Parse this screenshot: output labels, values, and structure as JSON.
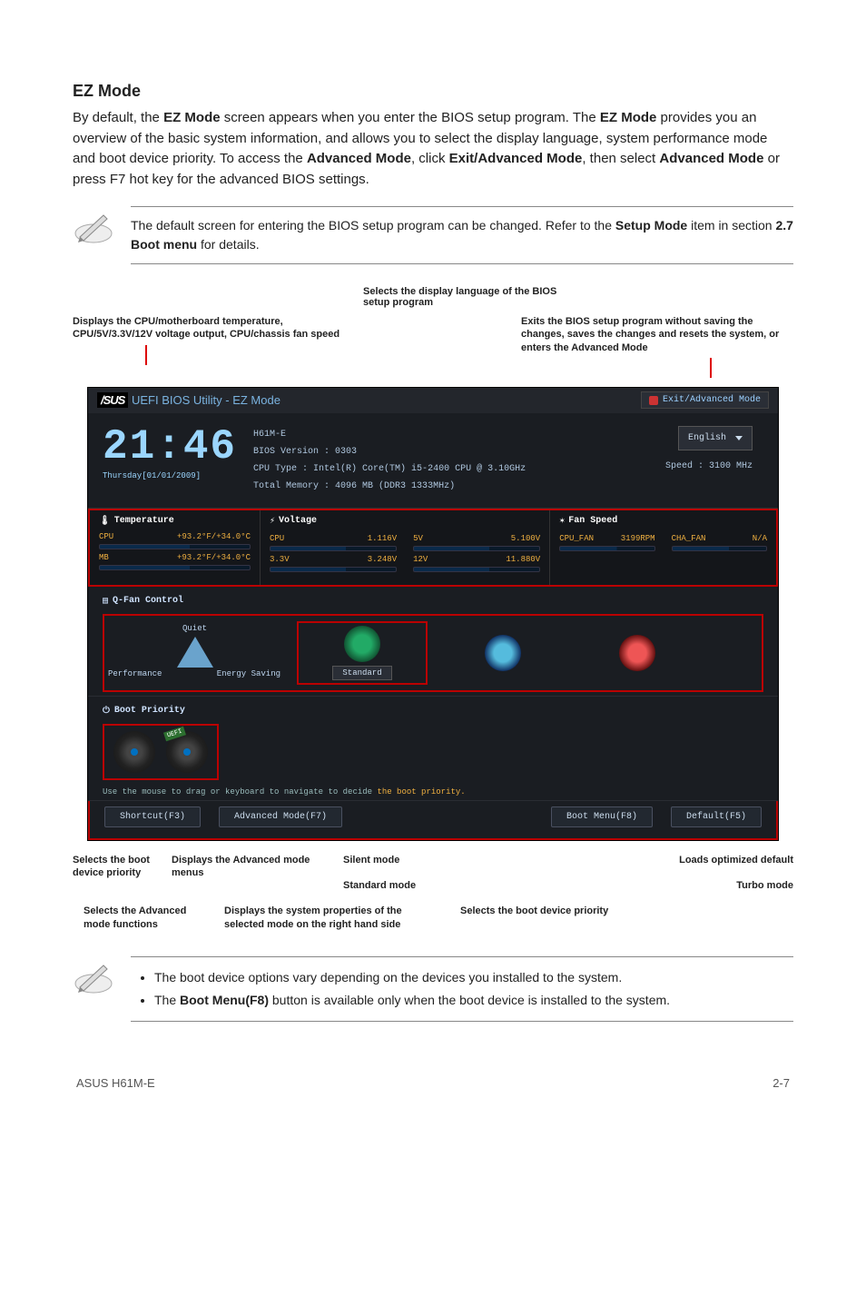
{
  "section_title": "EZ Mode",
  "body_paragraph_parts": [
    "By default, the ",
    "EZ Mode",
    " screen appears when you enter the BIOS setup program. The ",
    "EZ Mode",
    " provides you an overview of the basic system information, and allows you to select the display language, system performance mode and boot device priority. To access the ",
    "Advanced Mode",
    ", click ",
    "Exit/Advanced Mode",
    ", then select ",
    "Advanced Mode",
    " or press F7 hot key for the advanced BIOS settings."
  ],
  "note1_parts": [
    "The default screen for entering the BIOS setup program can be changed. Refer to the ",
    "Setup Mode",
    " item in section ",
    "2.7 Boot menu",
    " for details."
  ],
  "callouts": {
    "top_center": "Selects the display language of the BIOS setup program",
    "top_left": "Displays the CPU/motherboard temperature, CPU/5V/3.3V/12V voltage output, CPU/chassis fan speed",
    "top_right": "Exits the BIOS setup program without saving the changes, saves the changes and resets the system, or enters the Advanced Mode",
    "bottom_row1": {
      "boot_device": "Selects the boot device priority",
      "adv_menus": "Displays the Advanced mode menus",
      "silent": "Silent mode",
      "standard": "Standard mode",
      "loads_default": "Loads optimized default",
      "turbo": "Turbo mode"
    },
    "bottom_row2": {
      "adv_funcs": "Selects the Advanced mode functions",
      "sys_props": "Displays the system properties of the selected mode on the right hand side",
      "boot_prio": "Selects the boot device priority"
    }
  },
  "bios": {
    "brand": "/SUS",
    "header": "UEFI BIOS Utility - EZ Mode",
    "exit_label": "Exit/Advanced Mode",
    "clock": "21:46",
    "date": "Thursday[01/01/2009]",
    "board": "H61M-E",
    "bios_version": "BIOS Version : 0303",
    "cpu_type": "CPU Type : Intel(R) Core(TM) i5-2400 CPU @ 3.10GHz",
    "total_memory": "Total Memory : 4096 MB (DDR3 1333MHz)",
    "speed": "Speed : 3100 MHz",
    "language": "English",
    "temp_title": "Temperature",
    "temp_cpu_label": "CPU",
    "temp_cpu_val": "+93.2°F/+34.0°C",
    "temp_mb_label": "MB",
    "temp_mb_val": "+93.2°F/+34.0°C",
    "volt_title": "Voltage",
    "volt_cpu_label": "CPU",
    "volt_cpu_val": "1.116V",
    "volt_5v_label": "5V",
    "volt_5v_val": "5.100V",
    "volt_33_label": "3.3V",
    "volt_33_val": "3.248V",
    "volt_12_label": "12V",
    "volt_12_val": "11.880V",
    "fan_title": "Fan Speed",
    "fan_cpu_label": "CPU_FAN",
    "fan_cpu_val": "3199RPM",
    "fan_cha_label": "CHA_FAN",
    "fan_cha_val": "N/A",
    "qfan_title": "Q-Fan Control",
    "perf_quiet": "Quiet",
    "perf_perf": "Performance",
    "perf_energy": "Energy Saving",
    "perf_standard": "Standard",
    "boot_title": "Boot Priority",
    "uefi_tag": "UEFI",
    "drag_hint_a": "Use the mouse to drag or keyboard to navigate to decide ",
    "drag_hint_b": "the boot priority.",
    "shortcut": "Shortcut(F3)",
    "advanced": "Advanced Mode(F7)",
    "boot_menu": "Boot Menu(F8)",
    "default": "Default(F5)",
    "power_icon": "⏻",
    "fan_icon": "❋",
    "bars_icon": "▤"
  },
  "note2_bullet1": "The boot device options vary depending on the devices you installed to the system.",
  "note2_bullet2_parts": [
    "The ",
    "Boot Menu(F8)",
    " button is available only when the boot device is installed to the system."
  ],
  "footer_left": "ASUS H61M-E",
  "footer_right": "2-7"
}
